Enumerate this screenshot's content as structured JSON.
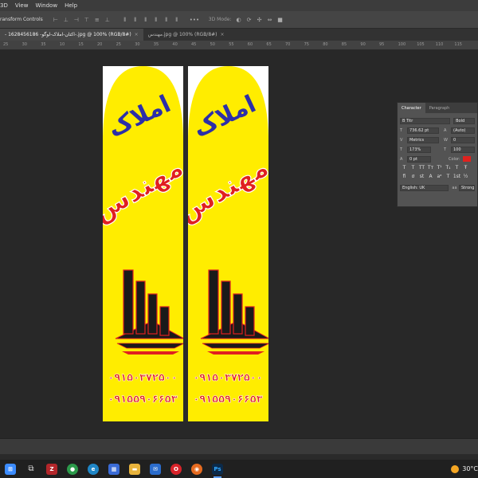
{
  "menu": [
    "3D",
    "View",
    "Window",
    "Help"
  ],
  "options": {
    "transform_label": "ransform Controls",
    "mode_label": "3D Mode:"
  },
  "tabs": [
    {
      "label": "- 1628456186 -اکتان-املاک-لوگو-.jpg @ 100% (RGB/8#)",
      "active": true
    },
    {
      "label": "مهندس.jpg @ 100% (RGB/8#)",
      "active": false
    }
  ],
  "ruler_ticks": [
    "25",
    "30",
    "35",
    "10",
    "15",
    "20",
    "25",
    "30",
    "35",
    "40",
    "45",
    "50",
    "55",
    "60",
    "65",
    "70",
    "75",
    "80",
    "85",
    "90",
    "95",
    "100",
    "105",
    "110",
    "115"
  ],
  "banner": {
    "title_line1": "املاک",
    "title_line2": "مهندس",
    "phone1": "۰۹۱۵۰۳۷۲۵۰۰",
    "phone2": "۰۹۱۵۵۹۰۶۶۵۳",
    "colors": {
      "yellow": "#ffed00",
      "blue": "#2c2fa8",
      "red": "#e02020",
      "black": "#1a1a1a"
    }
  },
  "character_panel": {
    "tab_character": "Character",
    "tab_paragraph": "Paragraph",
    "font_family": "B Titr",
    "font_style": "Bold",
    "font_size": "736.62 pt",
    "leading": "(Auto)",
    "kerning": "Metrics",
    "tracking": "0",
    "vertical_scale": "173%",
    "horizontal_scale": "100",
    "baseline_shift": "0 pt",
    "color_label": "Color:",
    "language": "English: UK",
    "antialias": "Strong",
    "color_value": "#e0221e"
  },
  "taskbar": {
    "weather_temp": "30°C"
  }
}
